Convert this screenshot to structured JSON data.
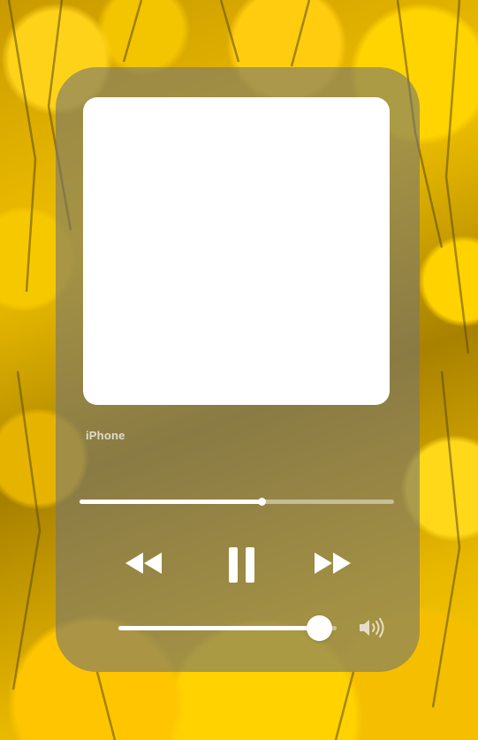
{
  "player": {
    "device_label": "iPhone",
    "progress": 0.58,
    "volume": 0.92
  },
  "icons": {
    "rewind": "rewind-icon",
    "pause": "pause-icon",
    "forward": "fast-forward-icon",
    "speaker": "speaker-volume-icon"
  },
  "colors": {
    "card_bg": "#78786e",
    "accent": "#ffffff",
    "wallpaper": "#f0c000"
  }
}
